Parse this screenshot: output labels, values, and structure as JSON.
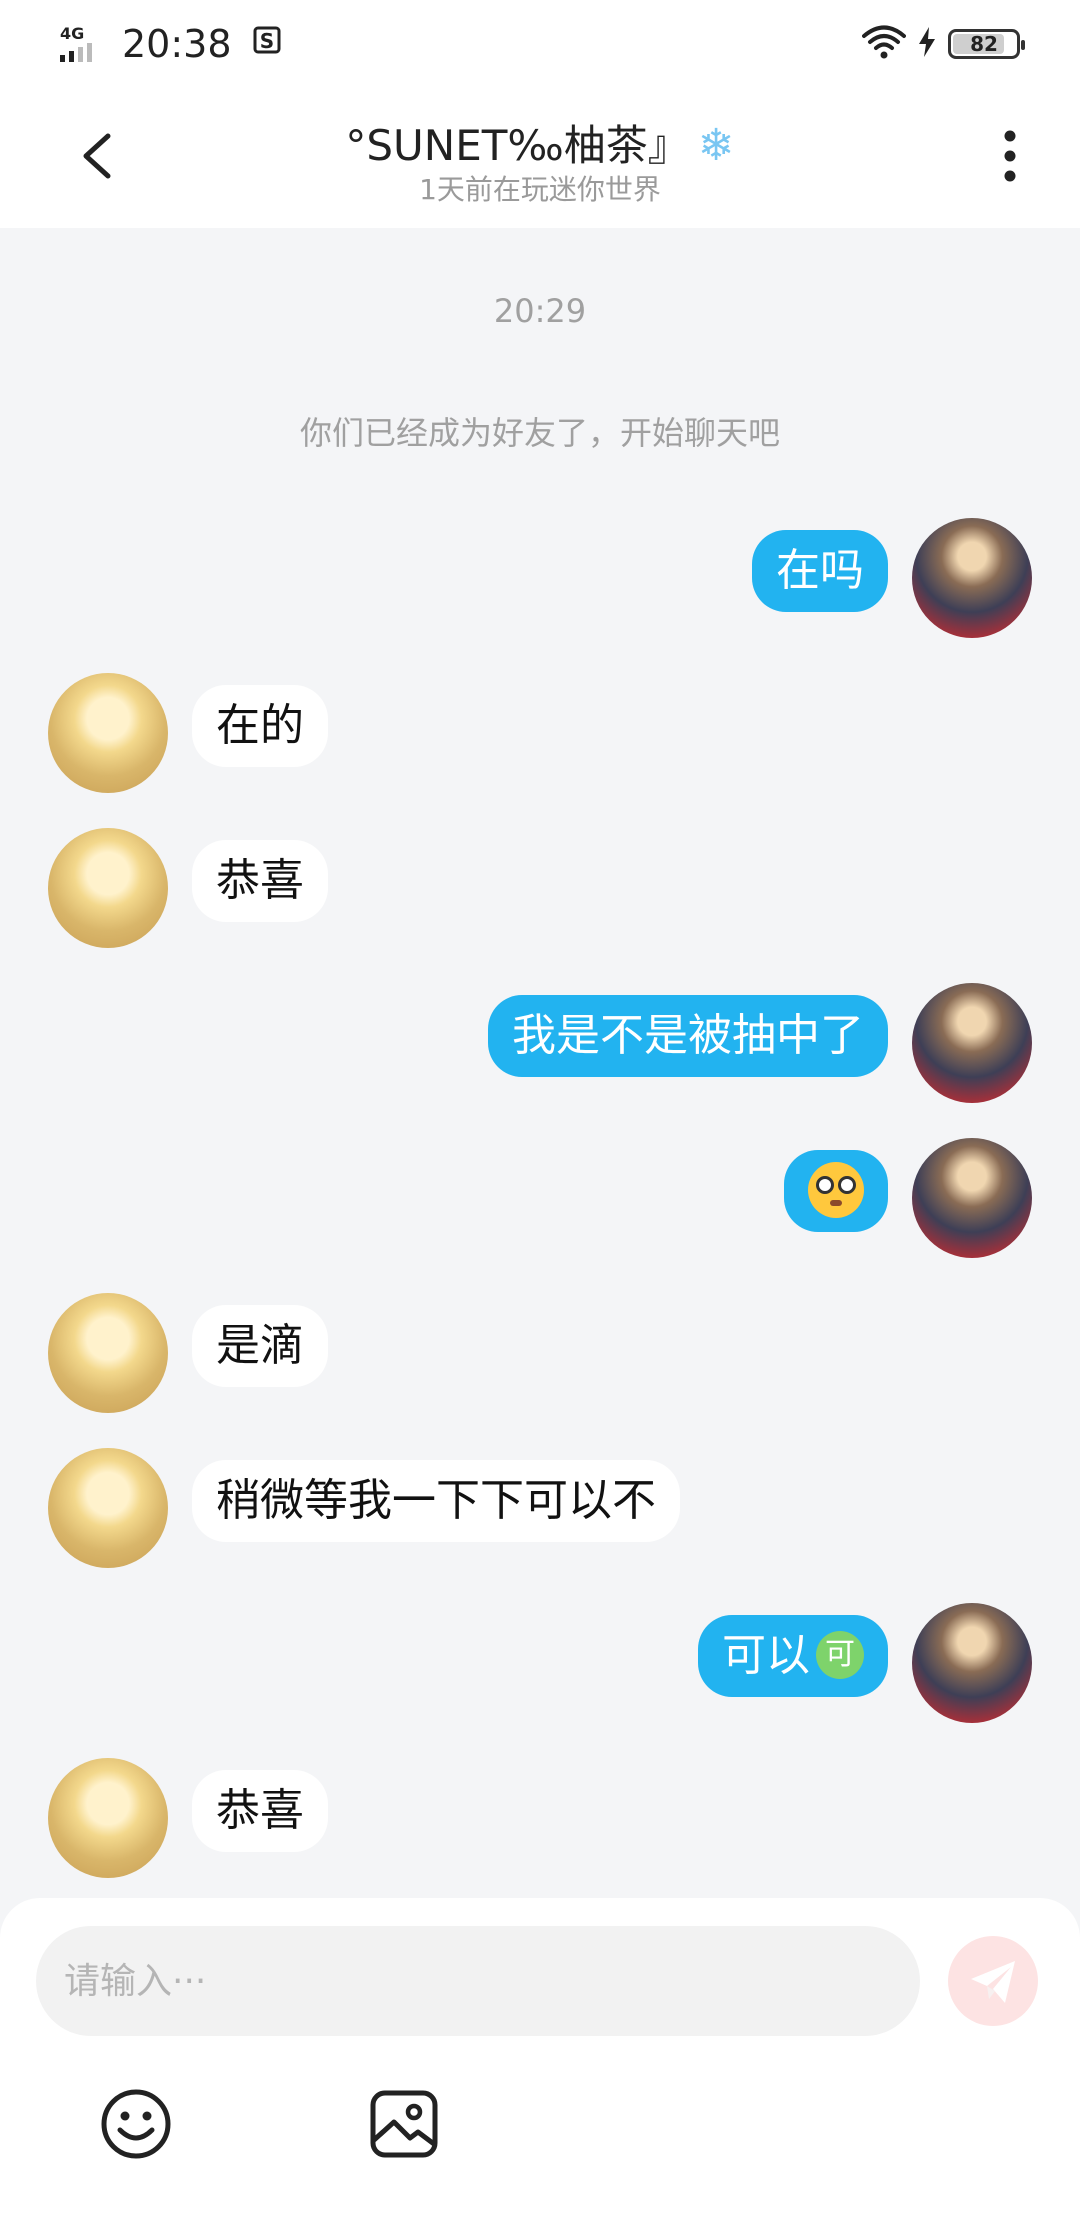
{
  "status_bar": {
    "network": "4G",
    "time": "20:38",
    "battery": "82",
    "battery_level": 0.82
  },
  "header": {
    "title": "°SUNET‰柚茶』",
    "subtitle": "1天前在玩迷你世界"
  },
  "chat": {
    "timestamp": "20:29",
    "system_message": "你们已经成为好友了，开始聊天吧",
    "messages": [
      {
        "side": "out",
        "text": "在吗"
      },
      {
        "side": "in",
        "text": "在的"
      },
      {
        "side": "in",
        "text": "恭喜"
      },
      {
        "side": "out",
        "text": "我是不是被抽中了"
      },
      {
        "side": "out",
        "text": "",
        "emoji": "flushed-face-emoji"
      },
      {
        "side": "in",
        "text": "是滴"
      },
      {
        "side": "in",
        "text": "稍微等我一下下可以不"
      },
      {
        "side": "out",
        "text": "可以",
        "badge": "可"
      },
      {
        "side": "in",
        "text": "恭喜"
      }
    ]
  },
  "input": {
    "placeholder": "请输入···"
  },
  "colors": {
    "outgoing_bubble": "#22b3f0",
    "incoming_bubble": "#ffffff",
    "background": "#f4f5f7",
    "send_button": "#fde3e3"
  },
  "icons": [
    "back-arrow-icon",
    "more-vertical-icon",
    "snowflake-icon",
    "send-icon",
    "emoji-icon",
    "image-icon"
  ]
}
